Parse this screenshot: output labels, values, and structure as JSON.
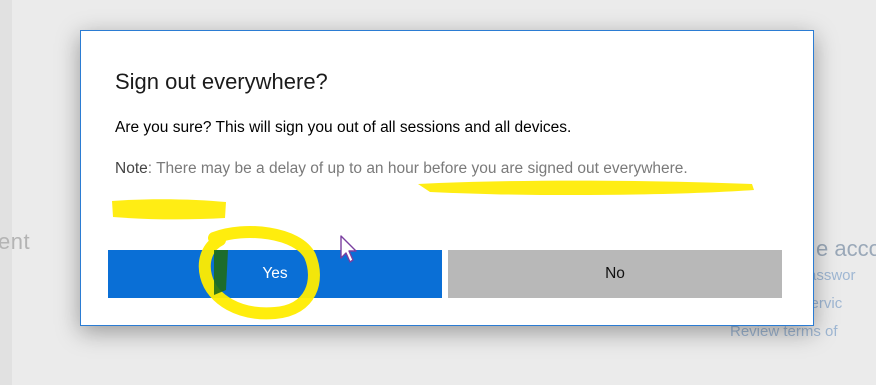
{
  "background": {
    "left_fragment": "ent",
    "right_heading": "e acco",
    "right_links": [
      "asswor",
      "Set up self servic",
      "Review terms of"
    ]
  },
  "dialog": {
    "title": "Sign out everywhere?",
    "message": "Are you sure? This will sign you out of all sessions and all devices.",
    "note_label": "Note",
    "note_text": ": There may be a delay of up to an hour before you are signed out everywhere.",
    "yes_label": "Yes",
    "no_label": "No"
  },
  "colors": {
    "primary_button": "#0a6fd6",
    "secondary_button": "#b8b8b8",
    "dialog_border": "#2b7cd3",
    "highlighter": "#ffec00"
  },
  "icons": {
    "cursor": "mouse-pointer-icon"
  }
}
